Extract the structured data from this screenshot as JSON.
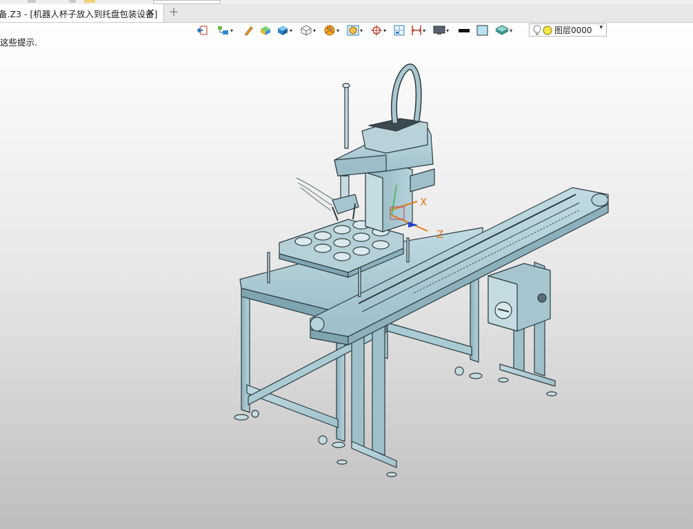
{
  "window": {
    "tab_title": "备.Z3 - [机器人杯子放入到托盘包装设备]",
    "tab_close_glyph": "✕",
    "add_tab_glyph": "+"
  },
  "viewport": {
    "hint_text": "这些提示."
  },
  "layer": {
    "name": "图层0000",
    "dropdown_glyph": "▾"
  },
  "triad": {
    "x_label": "X",
    "z_label": "Z"
  },
  "colors": {
    "model_fill": "#a9c6cf",
    "model_edge": "#2a3a40",
    "x_axis": "#e07a12",
    "z_axis": "#e07a12",
    "background_top": "#ffffff",
    "background_bottom": "#bdbdbd"
  },
  "icons": [
    "exit-sketch-icon",
    "part-tree-icon",
    "pencil-eraser-icon",
    "solid-color-icon",
    "box-shaded-icon",
    "wireframe-cube-icon",
    "pie-filter-icon",
    "render-mode-icon",
    "center-target-icon",
    "grid-icon",
    "dimension-icon",
    "monitor-icon",
    "line-style-icon",
    "color-swatch-icon",
    "layers-icon",
    "bulb-icon",
    "layer-circle-icon"
  ]
}
